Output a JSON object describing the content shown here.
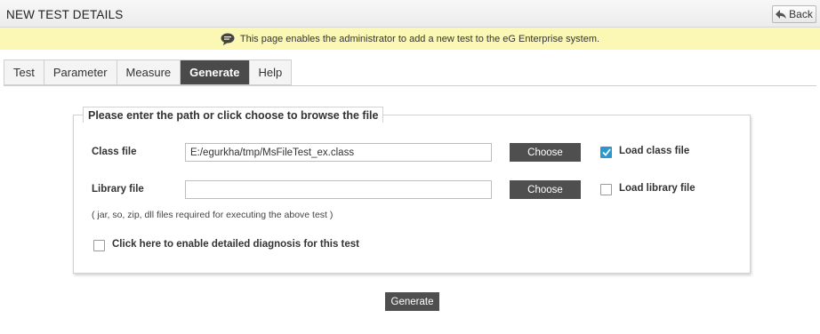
{
  "header": {
    "title": "NEW TEST DETAILS",
    "back_label": "Back"
  },
  "info": {
    "message": "This page enables the administrator to add a new test to the eG Enterprise system."
  },
  "tabs": [
    {
      "label": "Test",
      "active": false
    },
    {
      "label": "Parameter",
      "active": false
    },
    {
      "label": "Measure",
      "active": false
    },
    {
      "label": "Generate",
      "active": true
    },
    {
      "label": "Help",
      "active": false
    }
  ],
  "form": {
    "legend": "Please enter the path or click choose to browse the file",
    "class_file": {
      "label": "Class file",
      "value": "E:/egurkha/tmp/MsFileTest_ex.class",
      "choose_label": "Choose",
      "load_label": "Load class file",
      "load_checked": true
    },
    "library_file": {
      "label": "Library file",
      "value": "",
      "choose_label": "Choose",
      "load_label": "Load library file",
      "load_checked": false
    },
    "hint": "( jar, so, zip, dll files required for executing the above test )",
    "diagnosis": {
      "label": "Click here to enable detailed diagnosis for this test",
      "checked": false
    }
  },
  "generate_label": "Generate",
  "colors": {
    "info_bar": "#fbf7b5",
    "active_tab": "#4a4a4a",
    "button": "#4f4f4f",
    "check": "#2a97d0"
  }
}
